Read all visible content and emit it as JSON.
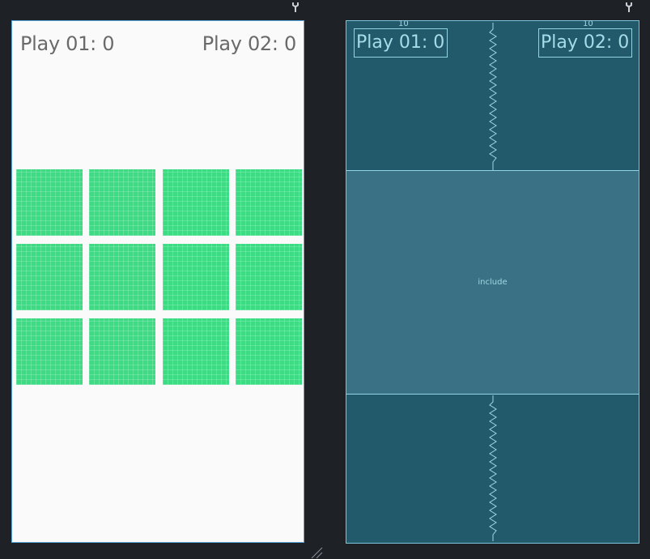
{
  "design": {
    "player1_score": "Play 01: 0",
    "player2_score": "Play 02: 0",
    "cards": [
      0,
      1,
      2,
      3,
      4,
      5,
      6,
      7,
      8,
      9,
      10,
      11
    ],
    "card_color": "#3ddc84"
  },
  "blueprint": {
    "player1_score": "Play 01: 0",
    "player2_score": "Play 02: 0",
    "include_label": "include",
    "margin_marker": "10"
  },
  "icons": [
    "wrench-icon",
    "resize-handle-icon"
  ]
}
